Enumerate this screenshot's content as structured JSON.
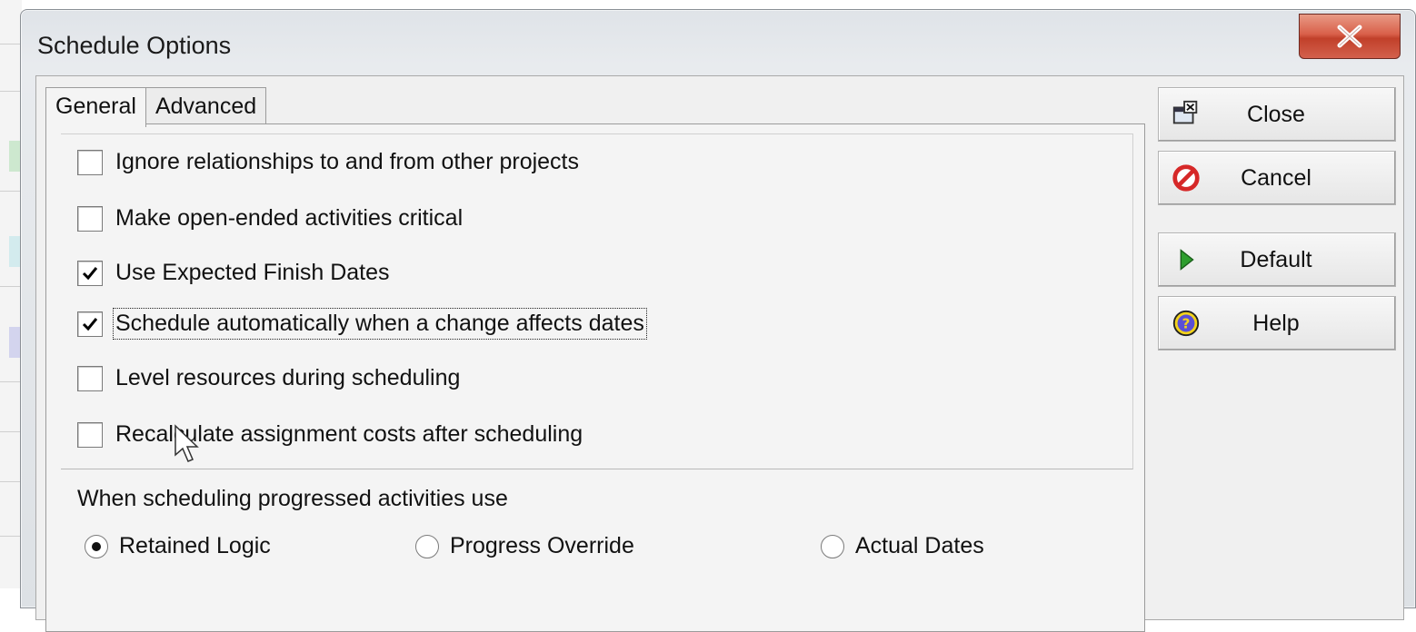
{
  "window": {
    "title": "Schedule Options",
    "close_glyph": "close-icon"
  },
  "tabs": [
    {
      "label": "General",
      "active": true
    },
    {
      "label": "Advanced",
      "active": false
    }
  ],
  "options": [
    {
      "label": "Ignore relationships to and from other projects",
      "checked": false
    },
    {
      "label": "Make open-ended activities critical",
      "checked": false
    },
    {
      "label": "Use Expected Finish Dates",
      "checked": true
    },
    {
      "label": "Schedule automatically when a change affects dates",
      "checked": true,
      "focused": true
    },
    {
      "label": "Level resources during scheduling",
      "checked": false
    },
    {
      "label": "Recalculate assignment costs after scheduling",
      "checked": false
    }
  ],
  "progressed": {
    "label": "When scheduling progressed activities use",
    "choices": [
      {
        "label": "Retained Logic",
        "selected": true
      },
      {
        "label": "Progress Override",
        "selected": false
      },
      {
        "label": "Actual Dates",
        "selected": false
      }
    ]
  },
  "buttons": [
    {
      "label": "Close",
      "icon": "close-window-icon"
    },
    {
      "label": "Cancel",
      "icon": "cancel-icon"
    },
    {
      "label": "Default",
      "icon": "play-arrow-icon"
    },
    {
      "label": "Help",
      "icon": "help-icon"
    }
  ],
  "colors": {
    "title_close": "#c1402a",
    "cancel_icon": "#d62828",
    "default_icon": "#2e9e2e",
    "help_icon": "#f2d21b"
  }
}
